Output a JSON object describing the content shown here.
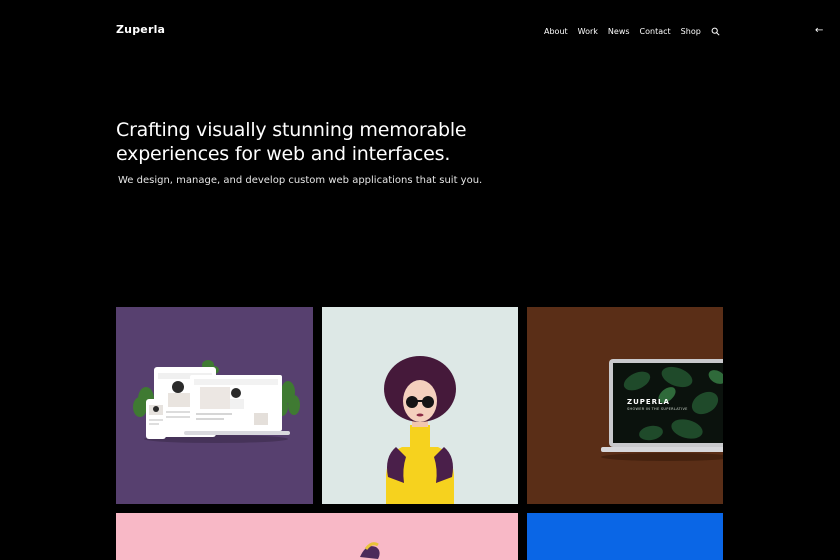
{
  "header": {
    "logo": "Zuperla",
    "nav": [
      "About",
      "Work",
      "News",
      "Contact",
      "Shop"
    ],
    "back_arrow": "←"
  },
  "hero": {
    "title": "Crafting visually stunning memorable experiences for web and interfaces.",
    "subtitle": "We design, manage, and develop custom web applications that suit you."
  },
  "portfolio": {
    "tiles": [
      {
        "color": "#57406f"
      },
      {
        "color": "#dde8e6"
      },
      {
        "color": "#5a2e17",
        "brand": "ZUPERLA",
        "tagline": "SHOWER IN THE SUPERLATIVE"
      },
      {
        "color": "#f8b8c6"
      },
      {
        "color": "#0a66e6"
      }
    ]
  },
  "icons": {
    "search": "search-icon",
    "back": "back-arrow-icon"
  },
  "colors": {
    "background": "#000000",
    "text": "#ffffff"
  }
}
